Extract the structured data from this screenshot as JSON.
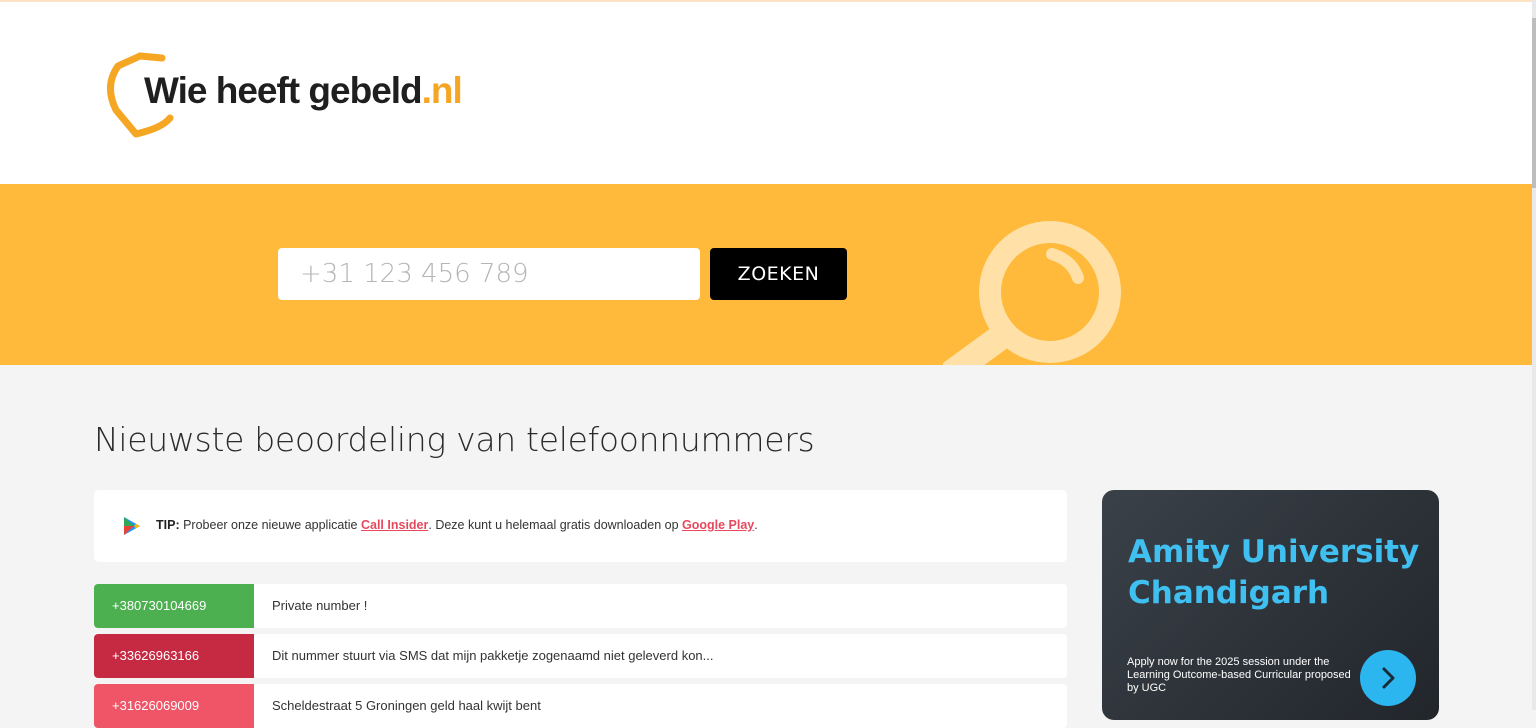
{
  "header": {
    "logo_text": "Wie heeft gebeld",
    "logo_tld": ".nl"
  },
  "search": {
    "placeholder": "+31 123 456 789",
    "button_label": "ZOEKEN"
  },
  "section": {
    "title": "Nieuwste beoordeling van telefoonnummers"
  },
  "tip": {
    "label": "TIP:",
    "text_before": " Probeer onze nieuwe applicatie ",
    "app_link": "Call Insider",
    "text_middle": ". Deze kunt u helemaal gratis downloaden op ",
    "store_link": "Google Play",
    "text_after": "."
  },
  "reviews": [
    {
      "number": "+380730104669",
      "comment": "Private number !",
      "color": "#4caf50"
    },
    {
      "number": "+33626963166",
      "comment": "Dit nummer stuurt via SMS dat mijn pakketje zogenaamd niet geleverd kon...",
      "color": "#c62a43"
    },
    {
      "number": "+31626069009",
      "comment": "Scheldestraat 5 Groningen geld haal kwijt bent",
      "color": "#ef5467"
    }
  ],
  "ad": {
    "title": "Amity University Chandigarh",
    "description": "Apply now for the 2025 session under the Learning Outcome-based Curricular proposed by UGC"
  },
  "colors": {
    "accent": "#ffb93b",
    "link": "#e8485e",
    "ad_title": "#3fc0f0"
  }
}
